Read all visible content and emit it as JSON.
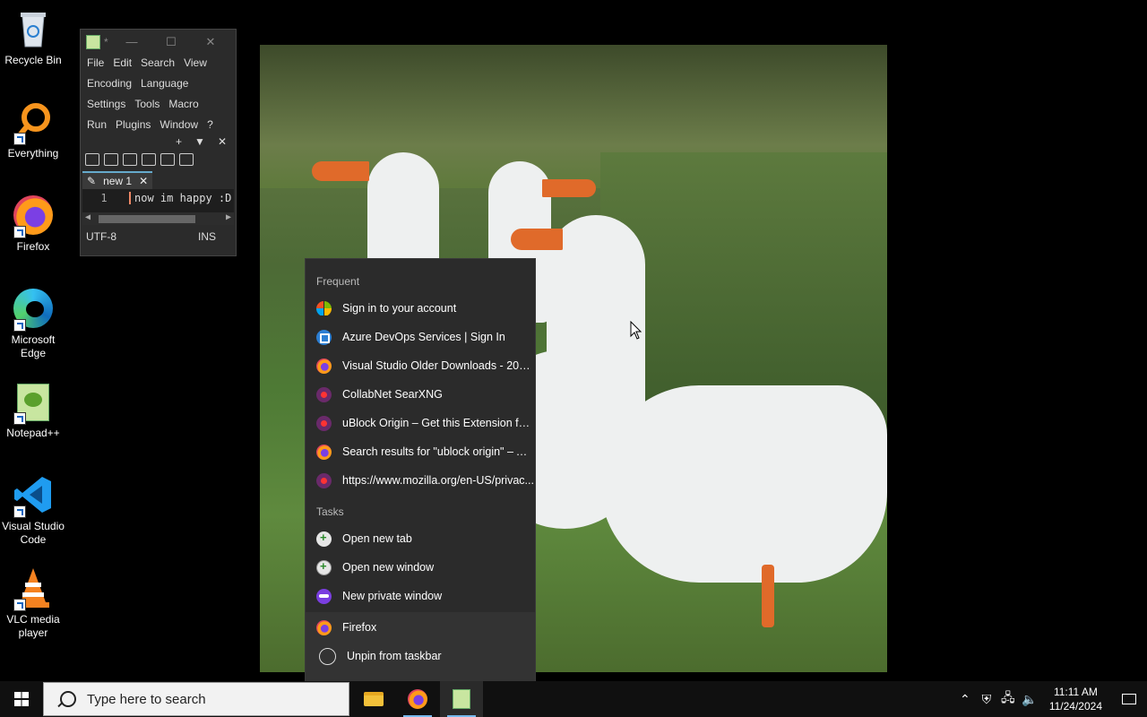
{
  "desktop": {
    "icons": [
      {
        "label": "Recycle Bin",
        "icon": "recycle-bin-icon"
      },
      {
        "label": "Everything",
        "icon": "everything-icon"
      },
      {
        "label": "Firefox",
        "icon": "firefox-icon"
      },
      {
        "label": "Microsoft Edge",
        "icon": "edge-icon"
      },
      {
        "label": "Notepad++",
        "icon": "notepadpp-icon"
      },
      {
        "label": "Visual Studio Code",
        "icon": "vscode-icon"
      },
      {
        "label": "VLC media player",
        "icon": "vlc-icon"
      }
    ]
  },
  "notepadpp": {
    "title_marker": "*",
    "menus": [
      [
        "File",
        "Edit",
        "Search",
        "View"
      ],
      [
        "Encoding",
        "Language"
      ],
      [
        "Settings",
        "Tools",
        "Macro"
      ],
      [
        "Run",
        "Plugins",
        "Window",
        "?"
      ]
    ],
    "tab_label": "new 1",
    "line_number": "1",
    "line_text": "now im happy :D",
    "encoding": "UTF-8",
    "mode": "INS"
  },
  "jumplist": {
    "frequent_header": "Frequent",
    "frequent": [
      {
        "label": "Sign in to your account",
        "icon": "microsoft-icon"
      },
      {
        "label": "Azure DevOps Services | Sign In",
        "icon": "azure-devops-icon"
      },
      {
        "label": "Visual Studio Older Downloads - 2019,...",
        "icon": "firefox-icon"
      },
      {
        "label": "CollabNet SearXNG",
        "icon": "site-icon"
      },
      {
        "label": "uBlock Origin – Get this Extension for...",
        "icon": "site-icon"
      },
      {
        "label": "Search results for \"ublock origin\" – Ad...",
        "icon": "firefox-icon"
      },
      {
        "label": "https://www.mozilla.org/en-US/privac...",
        "icon": "site-icon"
      }
    ],
    "tasks_header": "Tasks",
    "tasks": [
      {
        "label": "Open new tab",
        "icon": "new-tab-icon"
      },
      {
        "label": "Open new window",
        "icon": "new-window-icon"
      },
      {
        "label": "New private window",
        "icon": "private-window-icon"
      }
    ],
    "pinned": [
      {
        "label": "Firefox",
        "icon": "firefox-icon"
      },
      {
        "label": "Unpin from taskbar",
        "icon": "unpin-icon"
      }
    ]
  },
  "taskbar": {
    "search_placeholder": "Type here to search",
    "time": "11:11 AM",
    "date": "11/24/2024"
  },
  "colors": {
    "taskbar_bg": "#101010",
    "menu_bg": "#2b2b2b",
    "accent": "#76b9ed"
  }
}
